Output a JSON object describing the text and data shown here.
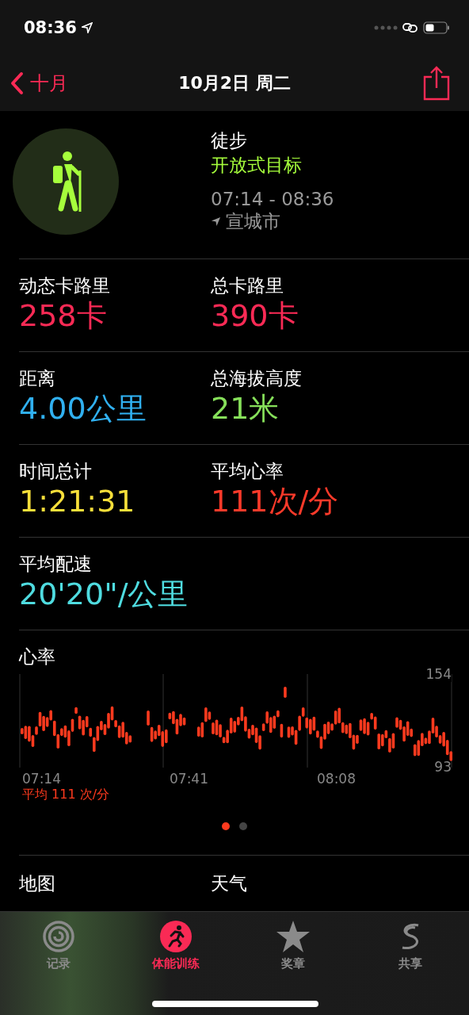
{
  "status_bar": {
    "time": "08:36"
  },
  "nav": {
    "back": "十月",
    "title": "10月2日 周二"
  },
  "workout": {
    "name": "徒步",
    "goal": "开放式目标",
    "time_range": "07:14 - 08:36",
    "location": "宣城市"
  },
  "metrics": [
    {
      "label": "动态卡路里",
      "value": "258卡",
      "color": "#fa2a55"
    },
    {
      "label": "总卡路里",
      "value": "390卡",
      "color": "#fa2a55"
    },
    {
      "label": "距离",
      "value": "4.00公里",
      "color": "#30b0f0"
    },
    {
      "label": "总海拔高度",
      "value": "21米",
      "color": "#86e05a"
    },
    {
      "label": "时间总计",
      "value": "1:21:31",
      "color": "#f7df3a"
    },
    {
      "label": "平均心率",
      "value": "111次/分",
      "color": "#ff3a2a"
    },
    {
      "label": "平均配速",
      "value": "20'20\"/公里",
      "color": "#4fdce0"
    }
  ],
  "heart_rate": {
    "title": "心率",
    "y_max": "154",
    "y_min": "93",
    "x_labels": [
      "07:14",
      "07:41",
      "08:08"
    ],
    "average": "平均 111 次/分"
  },
  "page_dots": [
    {
      "selected": true
    },
    {
      "selected": false
    }
  ],
  "sections": [
    "地图",
    "天气"
  ],
  "tab_bar": [
    {
      "label": "记录",
      "kind": "rings",
      "selected": false
    },
    {
      "label": "体能训练",
      "kind": "workout",
      "selected": true
    },
    {
      "label": "奖章",
      "kind": "awards",
      "selected": false
    },
    {
      "label": "共享",
      "kind": "sharing",
      "selected": false
    }
  ]
}
